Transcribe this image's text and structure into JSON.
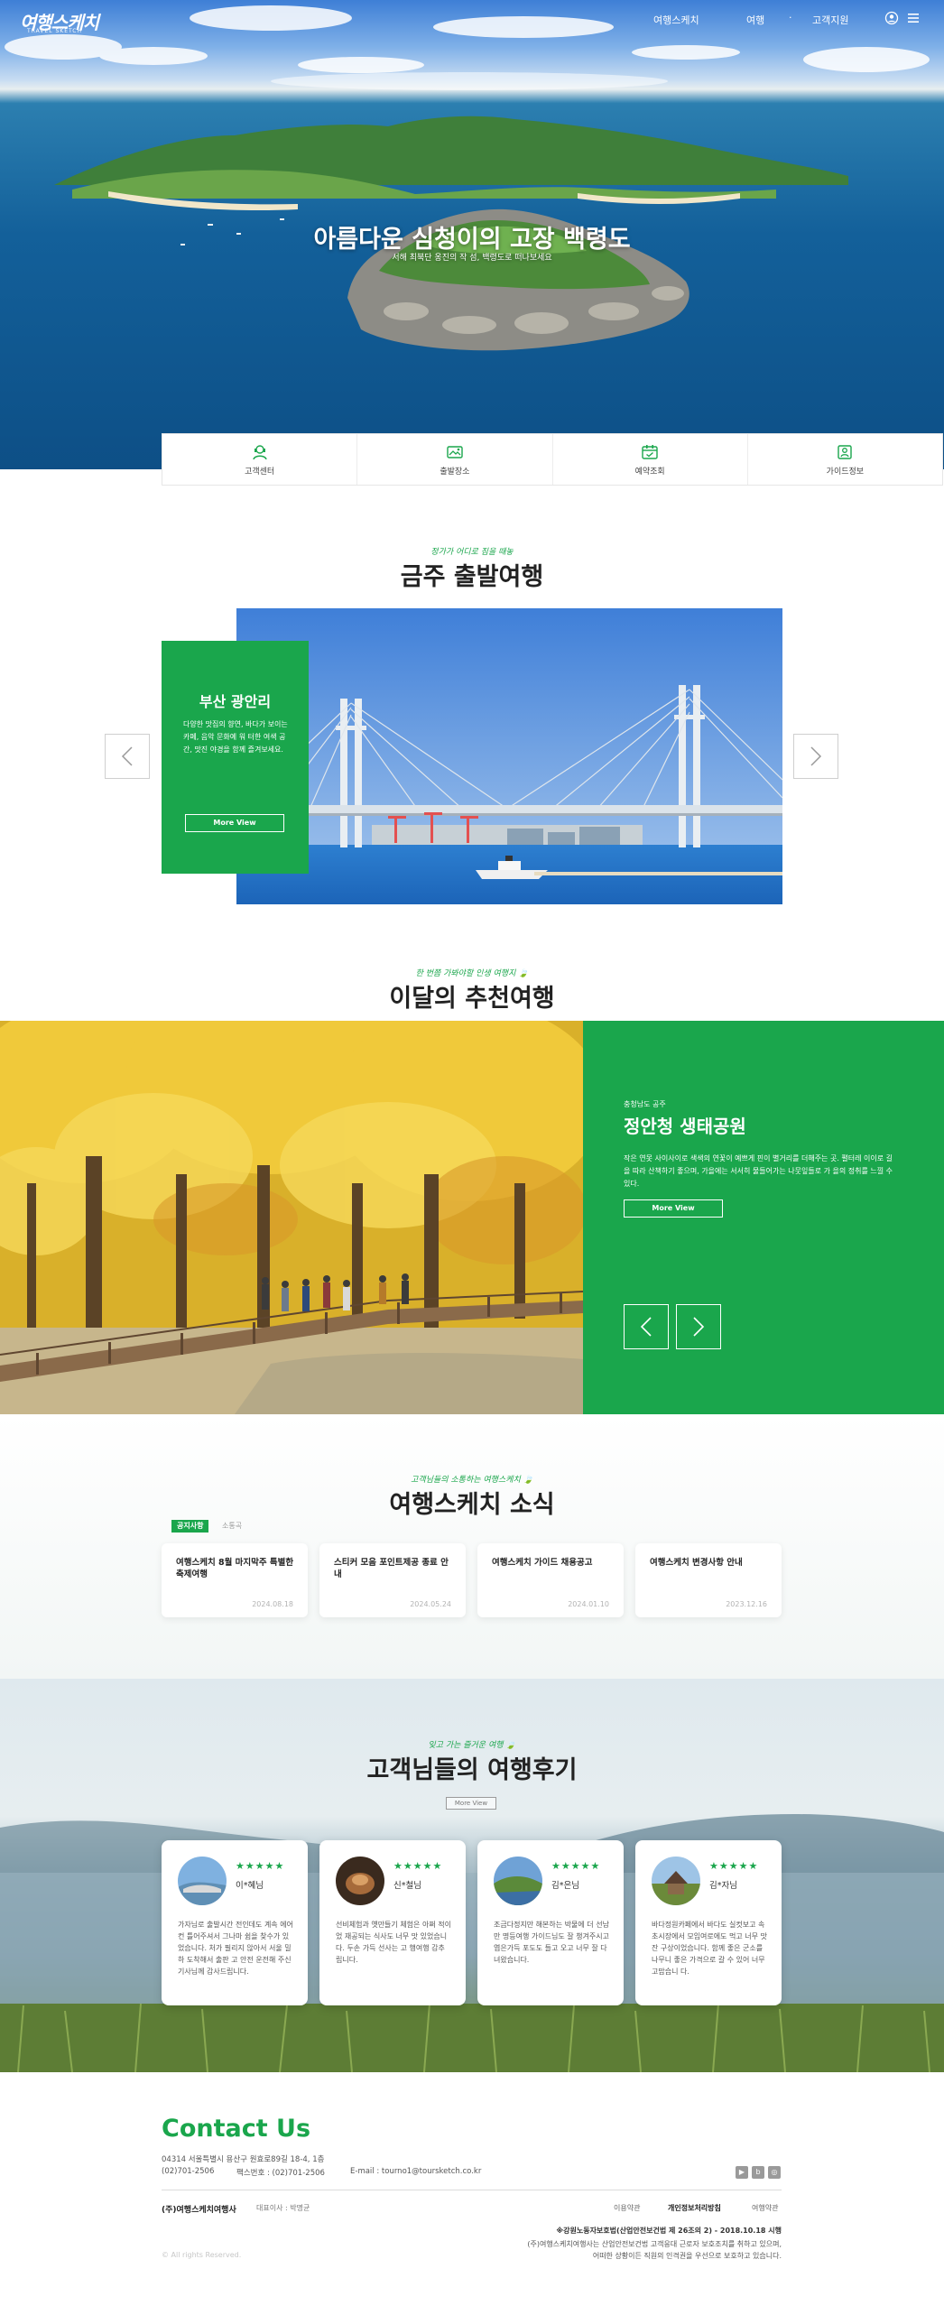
{
  "header": {
    "logo_text": "여행스케치",
    "logo_sub": "TRAVEL SKETCH",
    "nav": [
      "여행스케치",
      "여행",
      "·",
      "고객지원"
    ],
    "icons": [
      "user-icon",
      "menu-icon"
    ]
  },
  "hero": {
    "title": "아름다운 심청이의 고장 백령도",
    "subtitle": "서해 최북단 옹진의 작 섬, 백령도로 떠나보세요"
  },
  "quick_menu": [
    {
      "label": "고객센터",
      "icon": "customer-center-icon"
    },
    {
      "label": "출발장소",
      "icon": "departure-place-icon"
    },
    {
      "label": "예약조회",
      "icon": "reservation-check-icon"
    },
    {
      "label": "가이드정보",
      "icon": "guide-info-icon"
    }
  ],
  "section1": {
    "script": "정가가 어디로 짐을 때놓",
    "title": "금주 출발여행",
    "card": {
      "title": "부산 광안리",
      "desc": "다양한 맛집의 향연, 바다가 보이는 카페, 음악 문화예 워 터한 여색 공간, 맛진 야경을 함께 즐겨보세요.",
      "button": "More View"
    }
  },
  "section2": {
    "script": "한 번쯤 가봐야할 인생 여행지 🍃",
    "title": "이달의 추천여행",
    "region": "충청남도 공주",
    "place": "정안청 생태공원",
    "desc": "작은 연못 사이사이로 색색의 연꽃이 예쁘게 핀이 별거리를 더해주는 곳. 펼터레 이이로 길을 따라 산책하기 좋으며, 가을에는 서서히 물들어가는 나뭇잎들로 가 을의 정취를 느낄 수 있다.",
    "button": "More View"
  },
  "section3": {
    "script": "고객님들의 소통하는 여행스케치 🍃",
    "title": "여행스케치 소식",
    "tabs": [
      "공지사항",
      "소통곡"
    ],
    "news": [
      {
        "title": "여행스케치 8월 마지막주 특별한 축제여행",
        "date": "2024.08.18"
      },
      {
        "title": "스티커 모음 포인트제공 종료 안내",
        "date": "2024.05.24"
      },
      {
        "title": "여행스케치 가이드 채용공고",
        "date": "2024.01.10"
      },
      {
        "title": "여행스케치 변경사항 안내",
        "date": "2023.12.16"
      }
    ]
  },
  "section4": {
    "script": "잊고 가는 즐거운 여행 🍃",
    "title": "고객님들의 여행후기",
    "more": "More View",
    "stars": "★★★★★",
    "reviews": [
      {
        "name": "이*혜님",
        "text": "가자님로 출발시간 전인데도 계속 에어컨 틀어주셔서 그나마 쉼을 찾수가 있었습니다. 처가 필리지 않아서 서울 밀하 도착해서 출판 고 안전 운전해 주신 기사님께 감사드립니다."
      },
      {
        "name": "신*철님",
        "text": "선비체험과 옛만들기 체험은 아쩌 적이었 재공되는 식사도 너무 맛 있었습니다. 두손 가득 선사는 고 행여행 감추립니다."
      },
      {
        "name": "김*은님",
        "text": "조금다정지만 해본하는 박물에 더 선남만 명등여행 가이드님도 잘 챙겨주시고 엽은가득 포도도 들고 오고 너무 잘 다녀왔습니다."
      },
      {
        "name": "김*자님",
        "text": "바다정원카페에서 바다도 실컷보고 속초시장에서 모임여로에도 먹고 너무 맛잔 구상이었습니다. 함께 좋은 군소를 나무니 좋은 가격으로 갈 수 있어 너무 고맙습니 다."
      }
    ]
  },
  "footer": {
    "contact_title": "Contact Us",
    "address": "04314 서울특별시 용산구 원효로89길 18-4, 1층",
    "phone": "(02)701-2506",
    "fax": "팩스번호 : (02)701-2506",
    "email": "E-mail : tourno1@toursketch.co.kr",
    "company": "(주)여행스케치여행사",
    "ceo": "대표이사 : 박명균",
    "links": [
      "이용약관",
      "개인정보처리방침",
      "여행약관"
    ],
    "cert_title": "※강원노동자보호법(산업안전보건법 제 26조의 2) - 2018.10.18 시행",
    "cert_line1": "(주)여행스케치여행사는 산업안전보건법 고객응대 근로자 보호조치를 취하고 있으며,",
    "cert_line2": "어떠한 상황이든 직원의 인격권을 우선으로 보호하고 있습니다.",
    "copyright": "© All rights Reserved.",
    "social_icons": [
      "youtube-icon",
      "blog-icon",
      "instagram-icon"
    ]
  },
  "colors": {
    "brand_green": "#1aa64c",
    "text_dark": "#222222"
  }
}
